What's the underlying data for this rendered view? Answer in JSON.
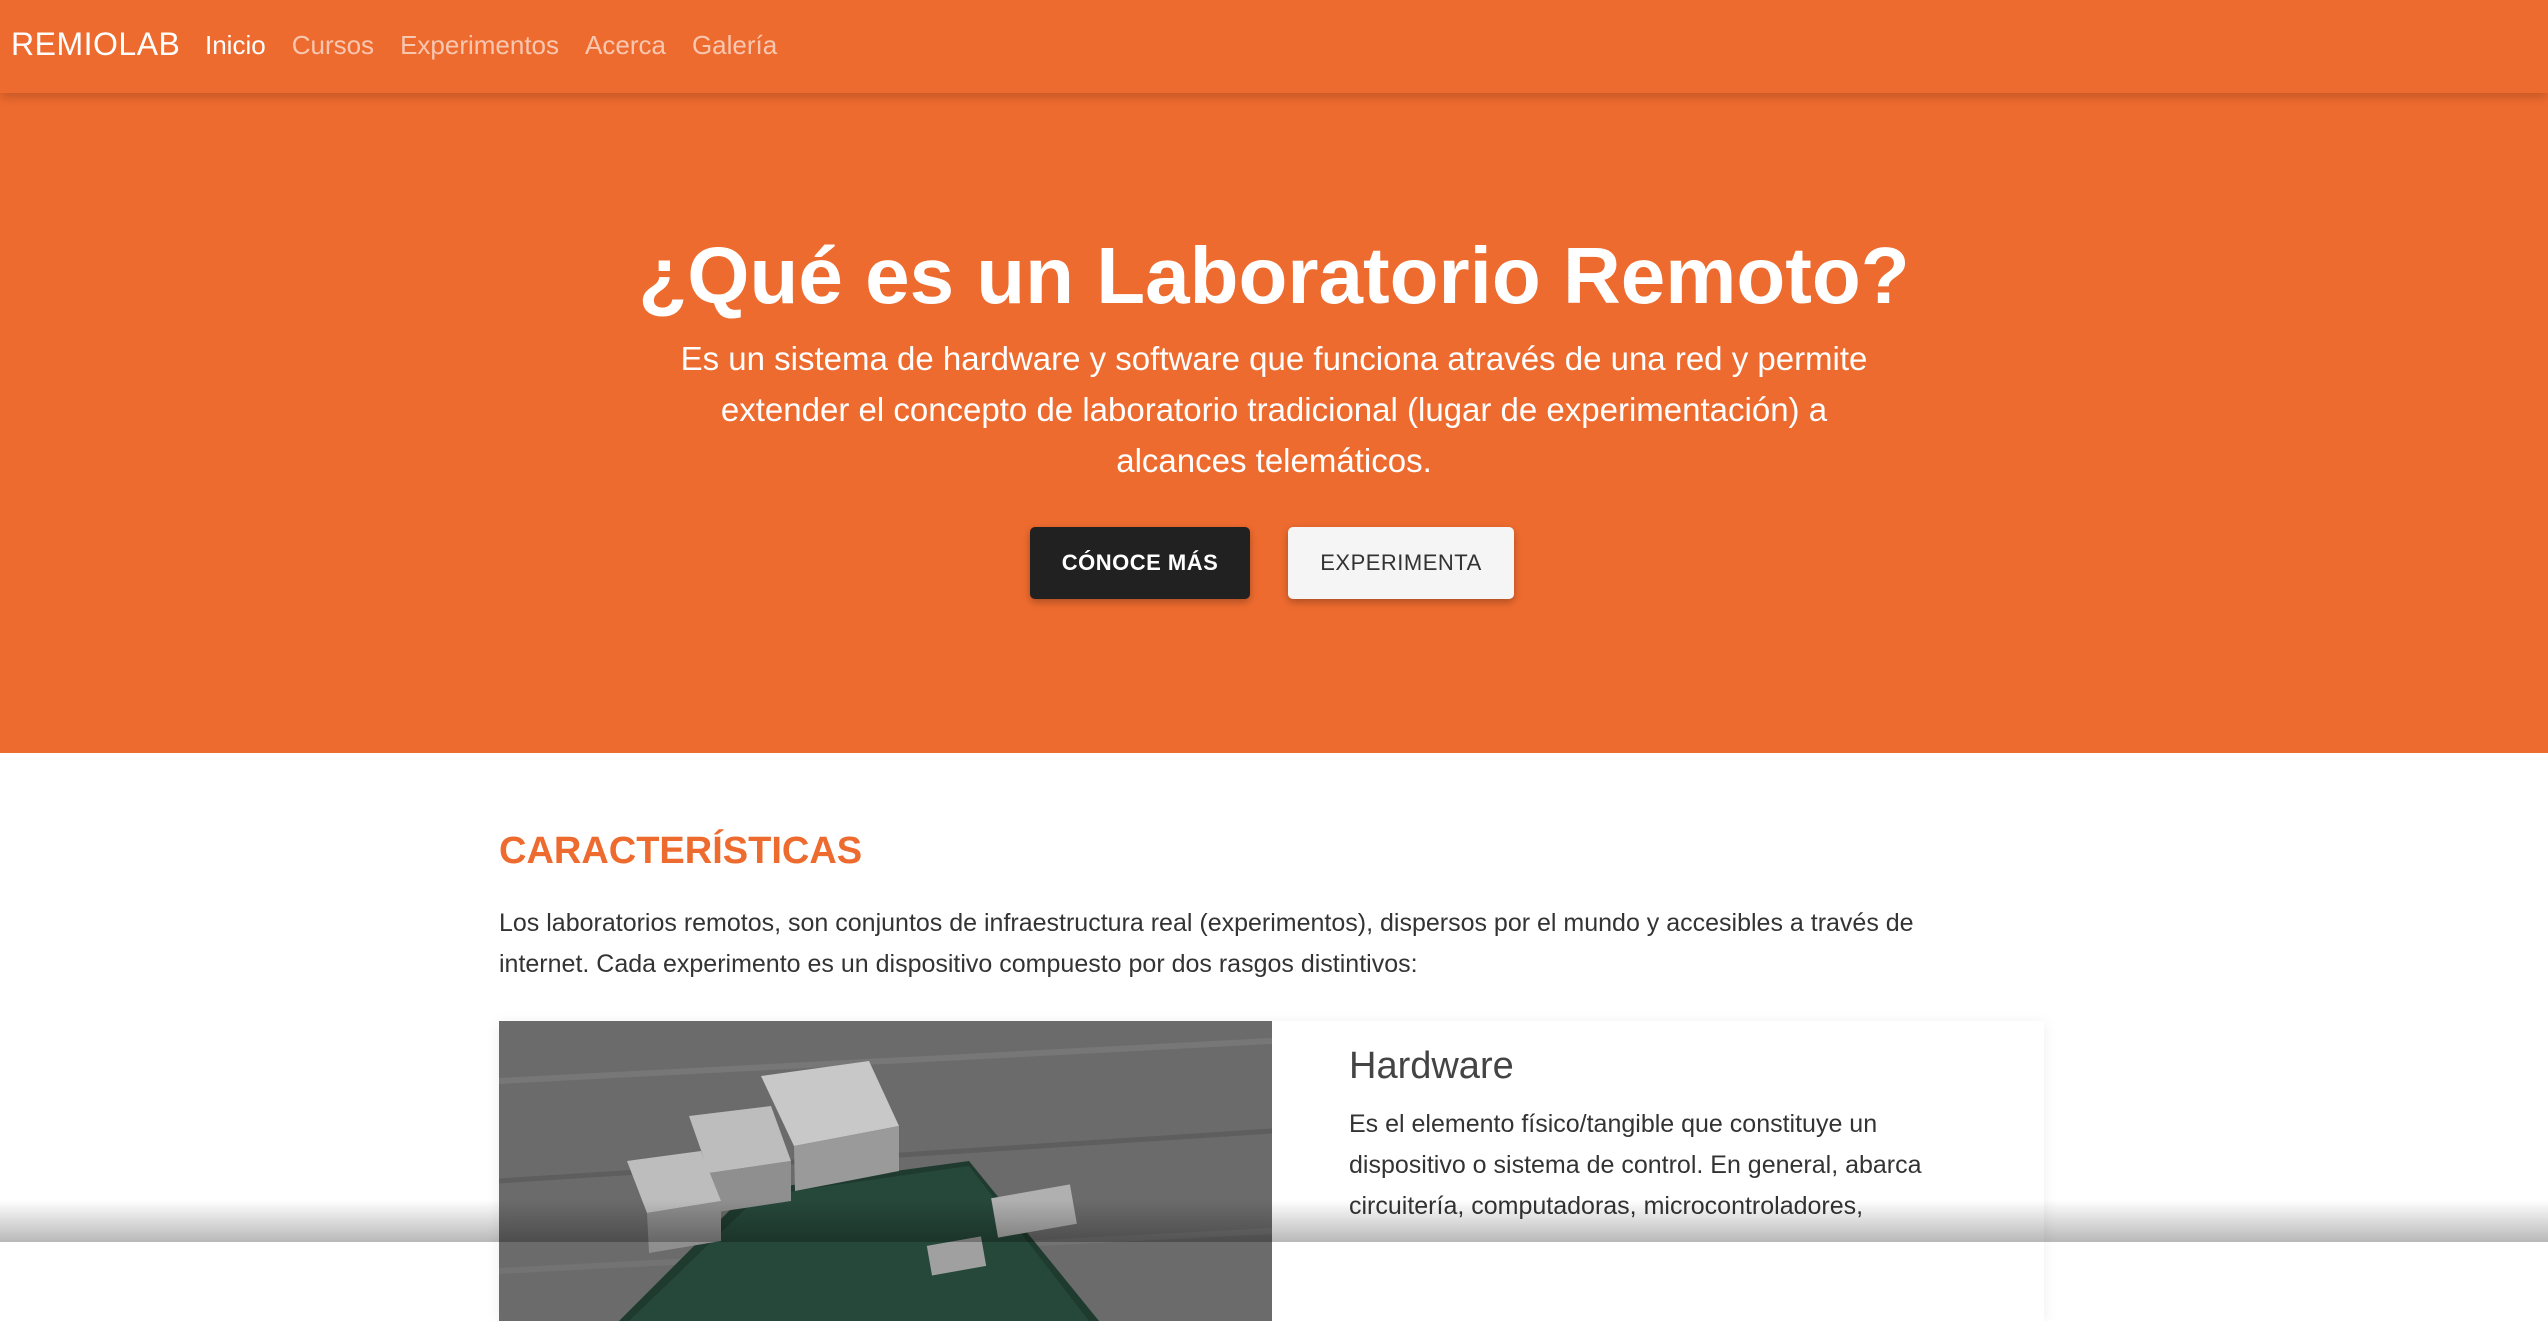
{
  "navbar": {
    "brand": "REMIOLAB",
    "links": [
      "Inicio",
      "Cursos",
      "Experimentos",
      "Acerca",
      "Galería"
    ]
  },
  "hero": {
    "title": "¿Qué es un Laboratorio Remoto?",
    "text": "Es un sistema de hardware y software que funciona através de una red y permite extender el concepto de laboratorio tradicional (lugar de experimentación) a alcances telemáticos.",
    "buttons": {
      "primary": "CÓNOCE MÁS",
      "secondary": "EXPERIMENTA"
    }
  },
  "features": {
    "title": "CARACTERÍSTICAS",
    "intro": "Los laboratorios remotos, son conjuntos de infraestructura real (experimentos), dispersos por el mundo y accesibles a través de internet. Cada experimento es un dispositivo compuesto por dos rasgos distintivos:",
    "card": {
      "title": "Hardware",
      "text": "Es el elemento físico/tangible que constituye un dispositivo o sistema de control. En general, abarca circuitería, computadoras, microcontroladores,"
    }
  },
  "colors": {
    "accent": "#ee6b2f",
    "dark_button": "#212121"
  }
}
